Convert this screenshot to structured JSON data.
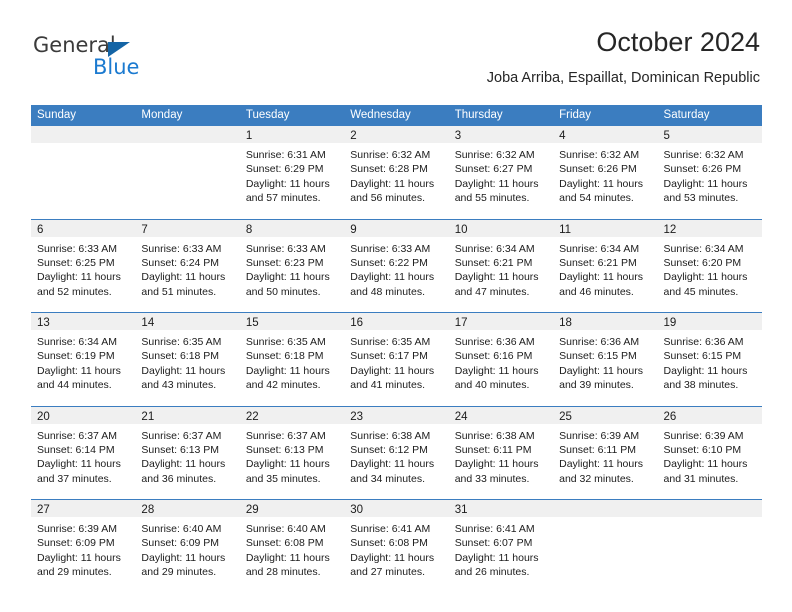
{
  "brand": {
    "name_part1": "General",
    "name_part2": "Blue",
    "triangle_color": "#1464a5",
    "blue_color": "#1b7ad0"
  },
  "header": {
    "title": "October 2024",
    "subtitle": "Joba Arriba, Espaillat, Dominican Republic"
  },
  "colors": {
    "header_bar": "#3b7dc0",
    "day_band": "#f0f0f0",
    "text": "#1c1c1c"
  },
  "weekdays": [
    "Sunday",
    "Monday",
    "Tuesday",
    "Wednesday",
    "Thursday",
    "Friday",
    "Saturday"
  ],
  "weeks": [
    [
      {
        "day": "",
        "sunrise": "",
        "sunset": "",
        "daylight1": "",
        "daylight2": ""
      },
      {
        "day": "",
        "sunrise": "",
        "sunset": "",
        "daylight1": "",
        "daylight2": ""
      },
      {
        "day": "1",
        "sunrise": "Sunrise: 6:31 AM",
        "sunset": "Sunset: 6:29 PM",
        "daylight1": "Daylight: 11 hours",
        "daylight2": "and 57 minutes."
      },
      {
        "day": "2",
        "sunrise": "Sunrise: 6:32 AM",
        "sunset": "Sunset: 6:28 PM",
        "daylight1": "Daylight: 11 hours",
        "daylight2": "and 56 minutes."
      },
      {
        "day": "3",
        "sunrise": "Sunrise: 6:32 AM",
        "sunset": "Sunset: 6:27 PM",
        "daylight1": "Daylight: 11 hours",
        "daylight2": "and 55 minutes."
      },
      {
        "day": "4",
        "sunrise": "Sunrise: 6:32 AM",
        "sunset": "Sunset: 6:26 PM",
        "daylight1": "Daylight: 11 hours",
        "daylight2": "and 54 minutes."
      },
      {
        "day": "5",
        "sunrise": "Sunrise: 6:32 AM",
        "sunset": "Sunset: 6:26 PM",
        "daylight1": "Daylight: 11 hours",
        "daylight2": "and 53 minutes."
      }
    ],
    [
      {
        "day": "6",
        "sunrise": "Sunrise: 6:33 AM",
        "sunset": "Sunset: 6:25 PM",
        "daylight1": "Daylight: 11 hours",
        "daylight2": "and 52 minutes."
      },
      {
        "day": "7",
        "sunrise": "Sunrise: 6:33 AM",
        "sunset": "Sunset: 6:24 PM",
        "daylight1": "Daylight: 11 hours",
        "daylight2": "and 51 minutes."
      },
      {
        "day": "8",
        "sunrise": "Sunrise: 6:33 AM",
        "sunset": "Sunset: 6:23 PM",
        "daylight1": "Daylight: 11 hours",
        "daylight2": "and 50 minutes."
      },
      {
        "day": "9",
        "sunrise": "Sunrise: 6:33 AM",
        "sunset": "Sunset: 6:22 PM",
        "daylight1": "Daylight: 11 hours",
        "daylight2": "and 48 minutes."
      },
      {
        "day": "10",
        "sunrise": "Sunrise: 6:34 AM",
        "sunset": "Sunset: 6:21 PM",
        "daylight1": "Daylight: 11 hours",
        "daylight2": "and 47 minutes."
      },
      {
        "day": "11",
        "sunrise": "Sunrise: 6:34 AM",
        "sunset": "Sunset: 6:21 PM",
        "daylight1": "Daylight: 11 hours",
        "daylight2": "and 46 minutes."
      },
      {
        "day": "12",
        "sunrise": "Sunrise: 6:34 AM",
        "sunset": "Sunset: 6:20 PM",
        "daylight1": "Daylight: 11 hours",
        "daylight2": "and 45 minutes."
      }
    ],
    [
      {
        "day": "13",
        "sunrise": "Sunrise: 6:34 AM",
        "sunset": "Sunset: 6:19 PM",
        "daylight1": "Daylight: 11 hours",
        "daylight2": "and 44 minutes."
      },
      {
        "day": "14",
        "sunrise": "Sunrise: 6:35 AM",
        "sunset": "Sunset: 6:18 PM",
        "daylight1": "Daylight: 11 hours",
        "daylight2": "and 43 minutes."
      },
      {
        "day": "15",
        "sunrise": "Sunrise: 6:35 AM",
        "sunset": "Sunset: 6:18 PM",
        "daylight1": "Daylight: 11 hours",
        "daylight2": "and 42 minutes."
      },
      {
        "day": "16",
        "sunrise": "Sunrise: 6:35 AM",
        "sunset": "Sunset: 6:17 PM",
        "daylight1": "Daylight: 11 hours",
        "daylight2": "and 41 minutes."
      },
      {
        "day": "17",
        "sunrise": "Sunrise: 6:36 AM",
        "sunset": "Sunset: 6:16 PM",
        "daylight1": "Daylight: 11 hours",
        "daylight2": "and 40 minutes."
      },
      {
        "day": "18",
        "sunrise": "Sunrise: 6:36 AM",
        "sunset": "Sunset: 6:15 PM",
        "daylight1": "Daylight: 11 hours",
        "daylight2": "and 39 minutes."
      },
      {
        "day": "19",
        "sunrise": "Sunrise: 6:36 AM",
        "sunset": "Sunset: 6:15 PM",
        "daylight1": "Daylight: 11 hours",
        "daylight2": "and 38 minutes."
      }
    ],
    [
      {
        "day": "20",
        "sunrise": "Sunrise: 6:37 AM",
        "sunset": "Sunset: 6:14 PM",
        "daylight1": "Daylight: 11 hours",
        "daylight2": "and 37 minutes."
      },
      {
        "day": "21",
        "sunrise": "Sunrise: 6:37 AM",
        "sunset": "Sunset: 6:13 PM",
        "daylight1": "Daylight: 11 hours",
        "daylight2": "and 36 minutes."
      },
      {
        "day": "22",
        "sunrise": "Sunrise: 6:37 AM",
        "sunset": "Sunset: 6:13 PM",
        "daylight1": "Daylight: 11 hours",
        "daylight2": "and 35 minutes."
      },
      {
        "day": "23",
        "sunrise": "Sunrise: 6:38 AM",
        "sunset": "Sunset: 6:12 PM",
        "daylight1": "Daylight: 11 hours",
        "daylight2": "and 34 minutes."
      },
      {
        "day": "24",
        "sunrise": "Sunrise: 6:38 AM",
        "sunset": "Sunset: 6:11 PM",
        "daylight1": "Daylight: 11 hours",
        "daylight2": "and 33 minutes."
      },
      {
        "day": "25",
        "sunrise": "Sunrise: 6:39 AM",
        "sunset": "Sunset: 6:11 PM",
        "daylight1": "Daylight: 11 hours",
        "daylight2": "and 32 minutes."
      },
      {
        "day": "26",
        "sunrise": "Sunrise: 6:39 AM",
        "sunset": "Sunset: 6:10 PM",
        "daylight1": "Daylight: 11 hours",
        "daylight2": "and 31 minutes."
      }
    ],
    [
      {
        "day": "27",
        "sunrise": "Sunrise: 6:39 AM",
        "sunset": "Sunset: 6:09 PM",
        "daylight1": "Daylight: 11 hours",
        "daylight2": "and 29 minutes."
      },
      {
        "day": "28",
        "sunrise": "Sunrise: 6:40 AM",
        "sunset": "Sunset: 6:09 PM",
        "daylight1": "Daylight: 11 hours",
        "daylight2": "and 29 minutes."
      },
      {
        "day": "29",
        "sunrise": "Sunrise: 6:40 AM",
        "sunset": "Sunset: 6:08 PM",
        "daylight1": "Daylight: 11 hours",
        "daylight2": "and 28 minutes."
      },
      {
        "day": "30",
        "sunrise": "Sunrise: 6:41 AM",
        "sunset": "Sunset: 6:08 PM",
        "daylight1": "Daylight: 11 hours",
        "daylight2": "and 27 minutes."
      },
      {
        "day": "31",
        "sunrise": "Sunrise: 6:41 AM",
        "sunset": "Sunset: 6:07 PM",
        "daylight1": "Daylight: 11 hours",
        "daylight2": "and 26 minutes."
      },
      {
        "day": "",
        "sunrise": "",
        "sunset": "",
        "daylight1": "",
        "daylight2": ""
      },
      {
        "day": "",
        "sunrise": "",
        "sunset": "",
        "daylight1": "",
        "daylight2": ""
      }
    ]
  ]
}
